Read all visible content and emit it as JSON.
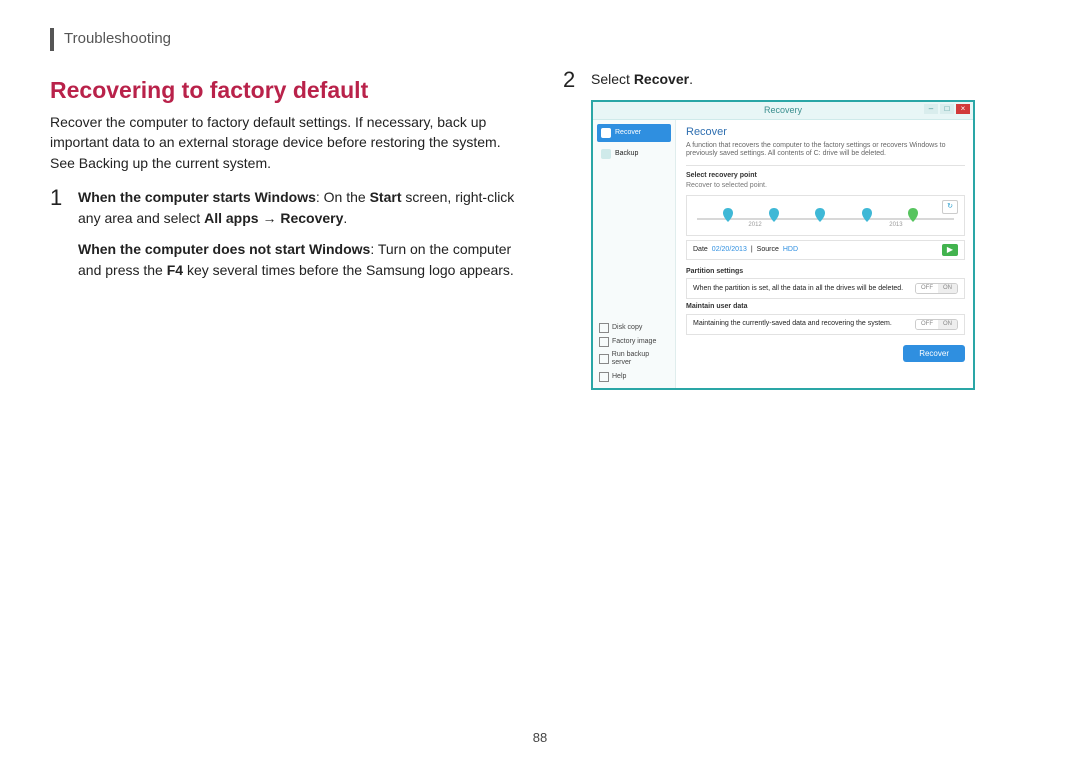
{
  "header": {
    "breadcrumb": "Troubleshooting"
  },
  "section": {
    "title": "Recovering to factory default",
    "intro": "Recover the computer to factory default settings. If necessary, back up important data to an external storage device before restoring the system. See Backing up the current system."
  },
  "steps": {
    "s1": {
      "num": "1",
      "a_bold": "When the computer starts Windows",
      "a_rest1": ": On the ",
      "a_bold2": "Start",
      "a_rest2": " screen, right-click any area and select ",
      "a_bold3": "All apps",
      "a_arrow": " → ",
      "a_bold4": "Recovery",
      "a_end": ".",
      "b_bold": "When the computer does not start Windows",
      "b_rest1": ": Turn on the computer and press the ",
      "b_bold2": "F4",
      "b_rest2": " key several times before the Samsung logo appears."
    },
    "s2": {
      "num": "2",
      "text1": "Select ",
      "bold": "Recover",
      "text2": "."
    }
  },
  "screenshot": {
    "title": "Recovery",
    "sidebar": {
      "recover": "Recover",
      "backup": "Backup",
      "links": {
        "disk": "Disk copy",
        "factory": "Factory image",
        "server": "Run backup server",
        "help": "Help"
      }
    },
    "main": {
      "heading": "Recover",
      "desc": "A function that recovers the computer to the factory settings or recovers Windows to previously saved settings. All contents of C: drive will be deleted.",
      "sec1_label": "Select recovery point",
      "sec1_sub": "Recover to selected point.",
      "tl_year1": "2012",
      "tl_year2": "2013",
      "info_date_lbl": "Date",
      "info_date": "02/20/2013",
      "info_src_lbl": "Source",
      "info_src": "HDD",
      "go": "▶",
      "sec2_label": "Partition settings",
      "sec2_text": "When the partition is set, all the data in all the drives will be deleted.",
      "sec3_label": "Maintain user data",
      "sec3_text": "Maintaining the currently-saved data and recovering the system.",
      "toggle_off": "OFF",
      "toggle_on": "ON",
      "button": "Recover"
    }
  },
  "page_number": "88"
}
